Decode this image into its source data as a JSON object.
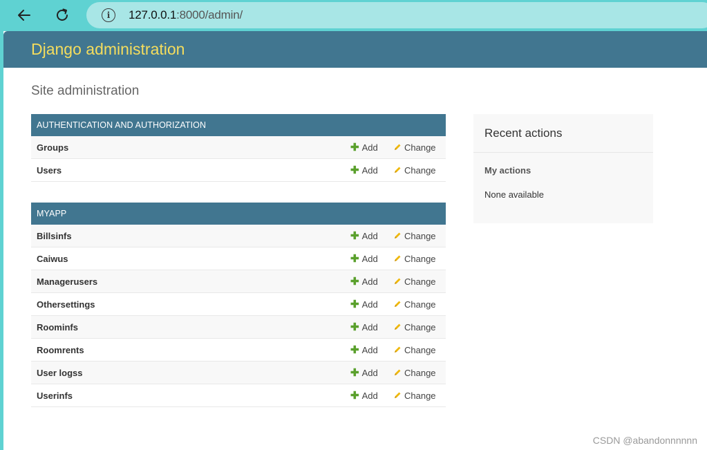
{
  "browser": {
    "url_host": "127.0.0.1",
    "url_rest": ":8000/admin/"
  },
  "header": {
    "site_name": "Django administration"
  },
  "content": {
    "title": "Site administration"
  },
  "apps": [
    {
      "caption": "AUTHENTICATION AND AUTHORIZATION",
      "models": [
        {
          "name": "Groups",
          "add_label": "Add",
          "change_label": "Change"
        },
        {
          "name": "Users",
          "add_label": "Add",
          "change_label": "Change"
        }
      ]
    },
    {
      "caption": "MYAPP",
      "models": [
        {
          "name": "Billsinfs",
          "add_label": "Add",
          "change_label": "Change"
        },
        {
          "name": "Caiwus",
          "add_label": "Add",
          "change_label": "Change"
        },
        {
          "name": "Managerusers",
          "add_label": "Add",
          "change_label": "Change"
        },
        {
          "name": "Othersettings",
          "add_label": "Add",
          "change_label": "Change"
        },
        {
          "name": "Roominfs",
          "add_label": "Add",
          "change_label": "Change"
        },
        {
          "name": "Roomrents",
          "add_label": "Add",
          "change_label": "Change"
        },
        {
          "name": "User logss",
          "add_label": "Add",
          "change_label": "Change"
        },
        {
          "name": "Userinfs",
          "add_label": "Add",
          "change_label": "Change"
        }
      ]
    }
  ],
  "recent_actions": {
    "title": "Recent actions",
    "subtitle": "My actions",
    "empty_text": "None available"
  },
  "watermark": "CSDN @abandonnnnnn",
  "colors": {
    "header_bg": "#417690",
    "site_name": "#f5dd5d",
    "add_icon": "#5aa02c",
    "change_icon": "#efb80b",
    "browser_chrome": "#5fd2d2"
  }
}
